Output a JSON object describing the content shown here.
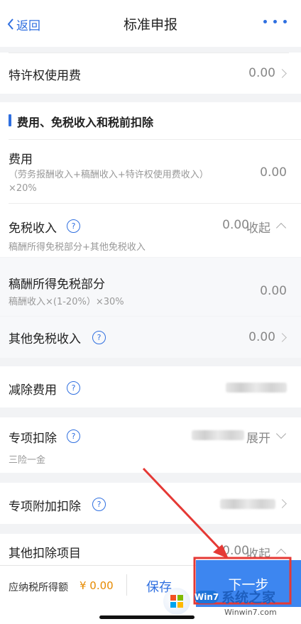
{
  "nav": {
    "back_label": "返回",
    "title": "标准申报"
  },
  "rows": {
    "franchise": {
      "label": "特许权使用费",
      "value": "0.00"
    },
    "section_title": "费用、免税收入和税前扣除",
    "expense": {
      "label": "费用",
      "formula": "（劳务报酬收入+稿酬收入+特许权使用费收入）",
      "formula_tail": "×20%",
      "value": "0.00"
    },
    "tax_free": {
      "label": "免税收入",
      "value": "0.00",
      "toggle": "收起",
      "sub": "稿酬所得免税部分+其他免税收入"
    },
    "royalty_free": {
      "label": "稿酬所得免税部分",
      "sub": "稿酬收入×(1-20%）×30%",
      "value": "0.00"
    },
    "other_free": {
      "label": "其他免税收入",
      "value": "0.00"
    },
    "deduct_fee": {
      "label": "减除费用"
    },
    "special": {
      "label": "专项扣除",
      "toggle": "展开",
      "sub": "三险一金"
    },
    "special_extra": {
      "label": "专项附加扣除"
    },
    "other_deduct": {
      "label": "其他扣除项目",
      "value": "0.00",
      "toggle": "收起"
    }
  },
  "footer": {
    "taxable_label": "应纳税所得额",
    "taxable_value": "¥ 0.00",
    "save_label": "保存",
    "next_label": "下一步"
  },
  "watermark": {
    "brand": "系统之家",
    "url": "Winwin7.com",
    "badge": "Win7"
  },
  "colors": {
    "accent": "#2f6fe0",
    "annotation_red": "#e53935",
    "background": "#f2f3f5"
  }
}
